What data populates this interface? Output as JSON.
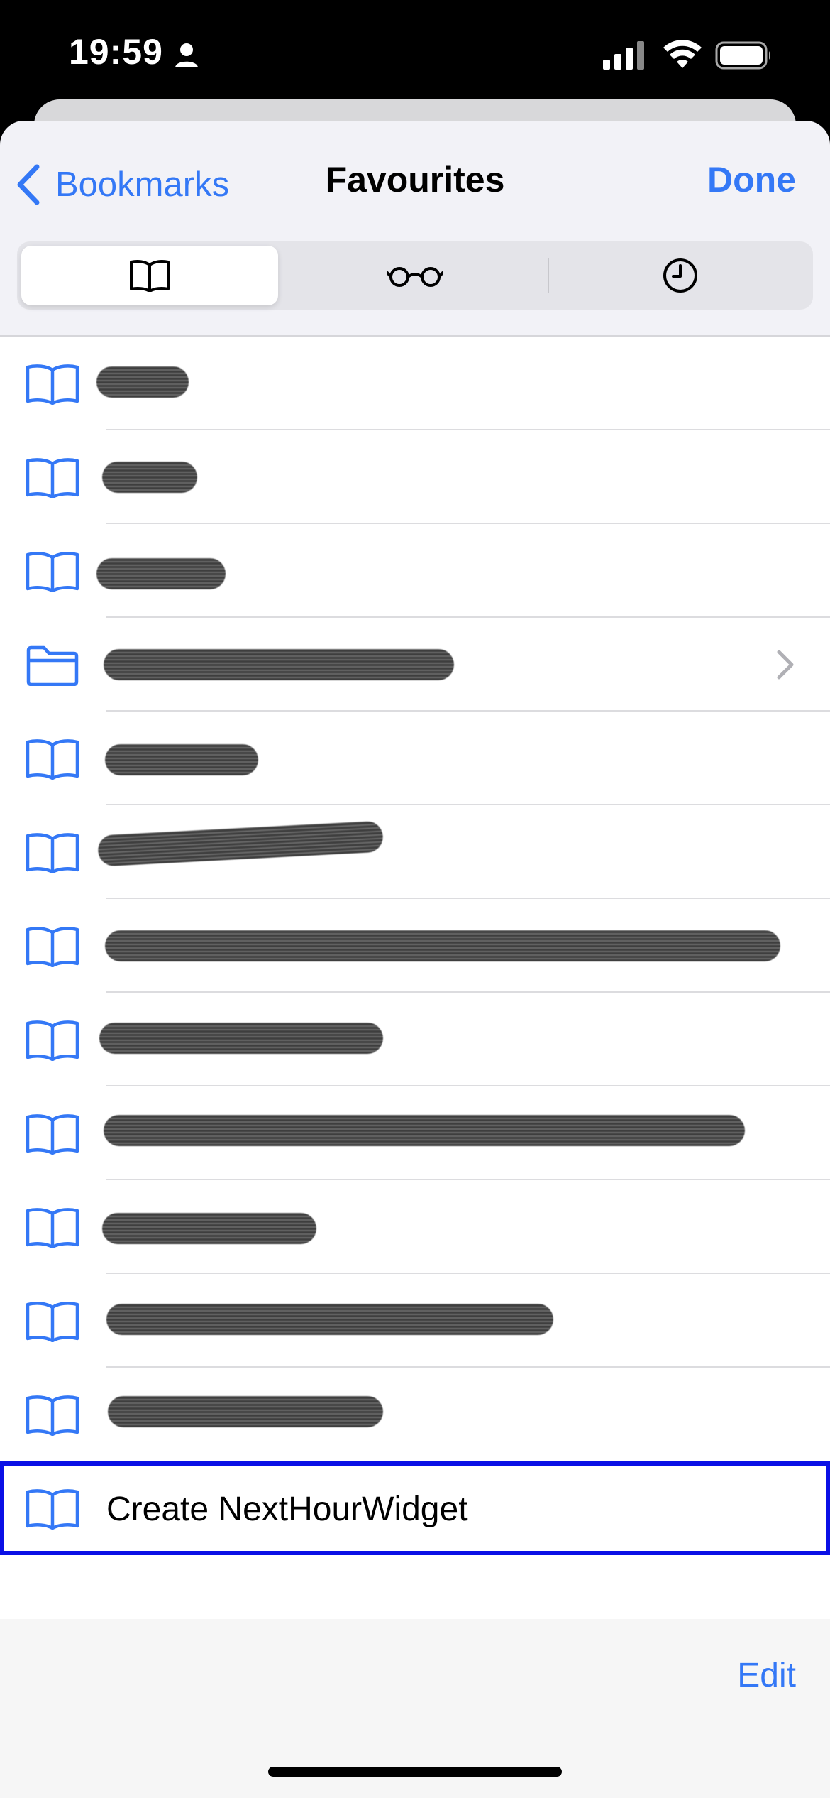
{
  "status_bar": {
    "time": "19:59"
  },
  "nav": {
    "back_label": "Bookmarks",
    "title": "Favourites",
    "done_label": "Done"
  },
  "segments": [
    {
      "name": "bookmarks",
      "icon": "book-icon",
      "selected": true
    },
    {
      "name": "reading-list",
      "icon": "glasses-icon",
      "selected": false
    },
    {
      "name": "history",
      "icon": "clock-icon",
      "selected": false
    }
  ],
  "rows": [
    {
      "label": "",
      "icon": "book-icon",
      "redacted": true
    },
    {
      "label": "",
      "icon": "book-icon",
      "redacted": true
    },
    {
      "label": "",
      "icon": "book-icon",
      "redacted": true
    },
    {
      "label": "",
      "icon": "folder-icon",
      "redacted": true,
      "has_chevron": true
    },
    {
      "label": "",
      "icon": "book-icon",
      "redacted": true
    },
    {
      "label": "",
      "icon": "book-icon",
      "redacted": true
    },
    {
      "label": "",
      "icon": "book-icon",
      "redacted": true
    },
    {
      "label": "",
      "icon": "book-icon",
      "redacted": true
    },
    {
      "label": "",
      "icon": "book-icon",
      "redacted": true
    },
    {
      "label": "",
      "icon": "book-icon",
      "redacted": true
    },
    {
      "label": "",
      "icon": "book-icon",
      "redacted": true
    },
    {
      "label": "",
      "icon": "book-icon",
      "redacted": true
    },
    {
      "label": "Create NextHourWidget",
      "icon": "book-icon",
      "redacted": false,
      "highlighted": true
    }
  ],
  "toolbar": {
    "edit_label": "Edit"
  },
  "colors": {
    "accent": "#3478f6",
    "highlight": "#0a10e6"
  }
}
